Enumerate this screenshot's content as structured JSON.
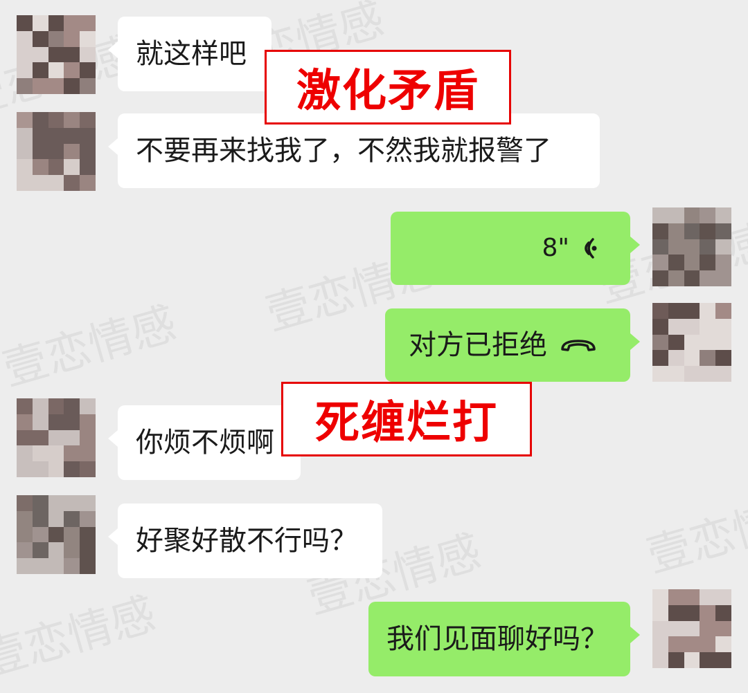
{
  "watermark": "壹恋情感",
  "messages": [
    {
      "side": "left",
      "text": "就这样吧"
    },
    {
      "side": "left",
      "text": "不要再来找我了，不然我就报警了"
    },
    {
      "side": "right",
      "type": "voice",
      "text": "8\""
    },
    {
      "side": "right",
      "type": "call",
      "text": "对方已拒绝"
    },
    {
      "side": "left",
      "text": "你烦不烦啊"
    },
    {
      "side": "left",
      "text": "好聚好散不行吗？"
    },
    {
      "side": "right",
      "text": "我们见面聊好吗？"
    }
  ],
  "annotations": [
    "激化矛盾",
    "死缠烂打"
  ],
  "colors": {
    "background": "#ededed",
    "incoming_bubble": "#ffffff",
    "outgoing_bubble": "#95ec69",
    "annotation": "#e60000"
  },
  "icons": [
    "voice-wave-icon",
    "hangup-phone-icon"
  ]
}
